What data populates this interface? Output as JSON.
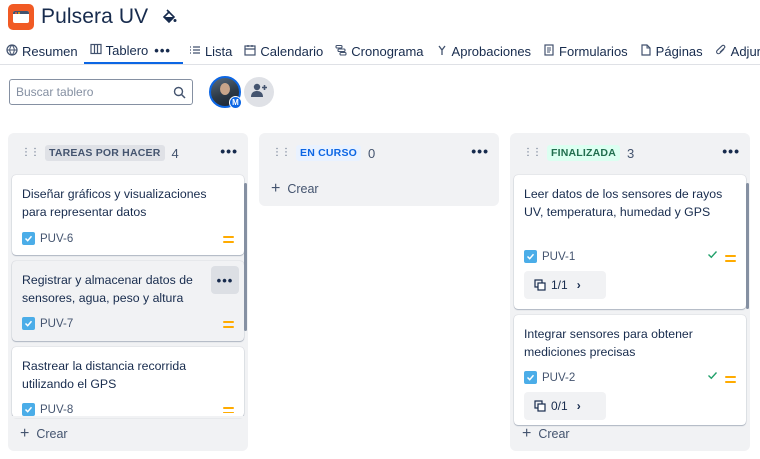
{
  "project": {
    "title": "Pulsera UV",
    "icon": "window-app-icon",
    "action_icon": "paint-bucket-icon"
  },
  "tabs": [
    {
      "label": "Resumen",
      "icon": "globe-icon"
    },
    {
      "label": "Tablero",
      "icon": "board-icon",
      "active": true
    },
    {
      "label": "Lista",
      "icon": "list-icon"
    },
    {
      "label": "Calendario",
      "icon": "calendar-icon"
    },
    {
      "label": "Cronograma",
      "icon": "timeline-icon"
    },
    {
      "label": "Aprobaciones",
      "icon": "approvals-icon"
    },
    {
      "label": "Formularios",
      "icon": "form-icon"
    },
    {
      "label": "Páginas",
      "icon": "page-icon"
    },
    {
      "label": "Adjunto",
      "icon": "attachment-icon"
    }
  ],
  "tabs_more": "•••",
  "search": {
    "placeholder": "Buscar tablero"
  },
  "avatar": {
    "badge": "M"
  },
  "colors": {
    "accent": "#0c66e4",
    "column_bg": "#f1f2f4",
    "priority": "#ffab00",
    "done_green": "#22a06b",
    "story_check": "#4bade8"
  },
  "columns": [
    {
      "name": "TAREAS POR HACER",
      "count": "4",
      "more": "•••",
      "create": "Crear",
      "cards": [
        {
          "title": "Diseñar gráficos y visualizaciones para representar datos",
          "key": "PUV-6",
          "priority": "medium"
        },
        {
          "title": "Registrar y almacenar datos de sensores, agua, peso y altura",
          "key": "PUV-7",
          "priority": "medium",
          "more": "•••"
        },
        {
          "title": "Rastrear la distancia recorrida utilizando el GPS",
          "key": "PUV-8",
          "priority": "medium"
        }
      ]
    },
    {
      "name": "EN CURSO",
      "count": "0",
      "more": "•••",
      "create": "Crear",
      "cards": []
    },
    {
      "name": "FINALIZADA",
      "count": "3",
      "more": "•••",
      "create": "Crear",
      "cards": [
        {
          "title": "Leer datos de los sensores de rayos UV, temperatura, humedad y GPS",
          "key": "PUV-1",
          "priority": "medium",
          "done": true,
          "subtasks": "1/1"
        },
        {
          "title": "Integrar sensores para obtener mediciones precisas",
          "key": "PUV-2",
          "priority": "medium",
          "done": true,
          "subtasks": "0/1"
        }
      ]
    }
  ]
}
